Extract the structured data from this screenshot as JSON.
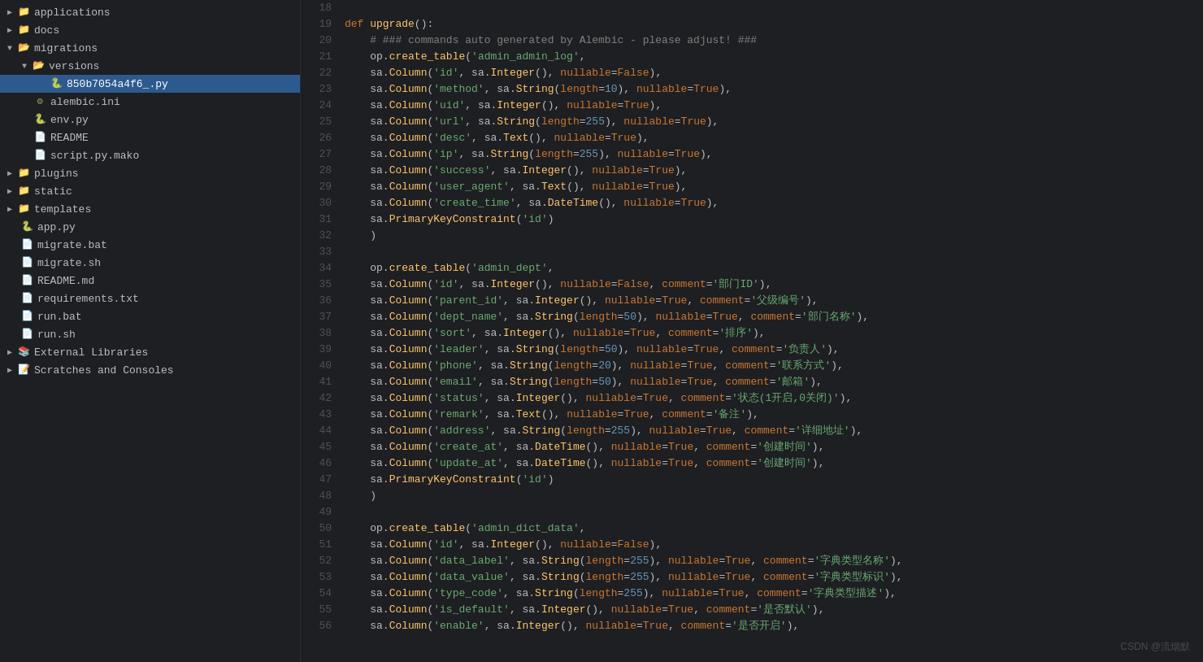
{
  "sidebar": {
    "items": [
      {
        "id": "applications",
        "label": "applications",
        "level": 1,
        "type": "folder",
        "expanded": false,
        "arrow": "▶"
      },
      {
        "id": "docs",
        "label": "docs",
        "level": 1,
        "type": "folder",
        "expanded": false,
        "arrow": "▶"
      },
      {
        "id": "migrations",
        "label": "migrations",
        "level": 1,
        "type": "folder",
        "expanded": true,
        "arrow": "▼"
      },
      {
        "id": "versions",
        "label": "versions",
        "level": 2,
        "type": "folder",
        "expanded": true,
        "arrow": "▼"
      },
      {
        "id": "850b7054a4f6_py",
        "label": "850b7054a4f6_.py",
        "level": 3,
        "type": "py",
        "selected": true
      },
      {
        "id": "alembic_ini",
        "label": "alembic.ini",
        "level": 2,
        "type": "ini"
      },
      {
        "id": "env_py",
        "label": "env.py",
        "level": 2,
        "type": "py"
      },
      {
        "id": "README",
        "label": "README",
        "level": 2,
        "type": "txt"
      },
      {
        "id": "script_py_mako",
        "label": "script.py.mako",
        "level": 2,
        "type": "mako"
      },
      {
        "id": "plugins",
        "label": "plugins",
        "level": 1,
        "type": "folder",
        "expanded": false,
        "arrow": "▶"
      },
      {
        "id": "static",
        "label": "static",
        "level": 1,
        "type": "folder",
        "expanded": false,
        "arrow": "▶"
      },
      {
        "id": "templates",
        "label": "templates",
        "level": 1,
        "type": "folder",
        "expanded": false,
        "arrow": "▶"
      },
      {
        "id": "app_py",
        "label": "app.py",
        "level": 1,
        "type": "py"
      },
      {
        "id": "migrate_bat",
        "label": "migrate.bat",
        "level": 1,
        "type": "bat"
      },
      {
        "id": "migrate_sh",
        "label": "migrate.sh",
        "level": 1,
        "type": "sh"
      },
      {
        "id": "README_md",
        "label": "README.md",
        "level": 1,
        "type": "md"
      },
      {
        "id": "requirements_txt",
        "label": "requirements.txt",
        "level": 1,
        "type": "txt"
      },
      {
        "id": "run_bat",
        "label": "run.bat",
        "level": 1,
        "type": "bat"
      },
      {
        "id": "run_sh",
        "label": "run.sh",
        "level": 1,
        "type": "sh"
      },
      {
        "id": "external_libraries",
        "label": "External Libraries",
        "level": 0,
        "type": "lib",
        "expanded": false,
        "arrow": "▶"
      },
      {
        "id": "scratches",
        "label": "Scratches and Consoles",
        "level": 0,
        "type": "scratch",
        "expanded": false,
        "arrow": "▶"
      }
    ]
  },
  "code_lines": [
    {
      "num": 18,
      "content": ""
    },
    {
      "num": 19,
      "content": "def_upgrade():"
    },
    {
      "num": 20,
      "content": "    # ### commands auto generated by Alembic - please adjust! ###"
    },
    {
      "num": 21,
      "content": "    op.create_table('admin_admin_log',"
    },
    {
      "num": 22,
      "content": "    sa.Column('id', sa.Integer(), nullable=False),"
    },
    {
      "num": 23,
      "content": "    sa.Column('method', sa.String(length=10), nullable=True),"
    },
    {
      "num": 24,
      "content": "    sa.Column('uid', sa.Integer(), nullable=True),"
    },
    {
      "num": 25,
      "content": "    sa.Column('url', sa.String(length=255), nullable=True),"
    },
    {
      "num": 26,
      "content": "    sa.Column('desc', sa.Text(), nullable=True),"
    },
    {
      "num": 27,
      "content": "    sa.Column('ip', sa.String(length=255), nullable=True),"
    },
    {
      "num": 28,
      "content": "    sa.Column('success', sa.Integer(), nullable=True),"
    },
    {
      "num": 29,
      "content": "    sa.Column('user_agent', sa.Text(), nullable=True),"
    },
    {
      "num": 30,
      "content": "    sa.Column('create_time', sa.DateTime(), nullable=True),"
    },
    {
      "num": 31,
      "content": "    sa.PrimaryKeyConstraint('id')"
    },
    {
      "num": 32,
      "content": "    )"
    },
    {
      "num": 33,
      "content": ""
    },
    {
      "num": 34,
      "content": "    op.create_table('admin_dept',"
    },
    {
      "num": 35,
      "content": "    sa.Column('id', sa.Integer(), nullable=False, comment='部门ID'),"
    },
    {
      "num": 36,
      "content": "    sa.Column('parent_id', sa.Integer(), nullable=True, comment='父级编号'),"
    },
    {
      "num": 37,
      "content": "    sa.Column('dept_name', sa.String(length=50), nullable=True, comment='部门名称'),"
    },
    {
      "num": 38,
      "content": "    sa.Column('sort', sa.Integer(), nullable=True, comment='排序'),"
    },
    {
      "num": 39,
      "content": "    sa.Column('leader', sa.String(length=50), nullable=True, comment='负责人'),"
    },
    {
      "num": 40,
      "content": "    sa.Column('phone', sa.String(length=20), nullable=True, comment='联系方式'),"
    },
    {
      "num": 41,
      "content": "    sa.Column('email', sa.String(length=50), nullable=True, comment='邮箱'),"
    },
    {
      "num": 42,
      "content": "    sa.Column('status', sa.Integer(), nullable=True, comment='状态(1开启,0关闭)'),"
    },
    {
      "num": 43,
      "content": "    sa.Column('remark', sa.Text(), nullable=True, comment='备注'),"
    },
    {
      "num": 44,
      "content": "    sa.Column('address', sa.String(length=255), nullable=True, comment='详细地址'),"
    },
    {
      "num": 45,
      "content": "    sa.Column('create_at', sa.DateTime(), nullable=True, comment='创建时间'),"
    },
    {
      "num": 46,
      "content": "    sa.Column('update_at', sa.DateTime(), nullable=True, comment='创建时间'),"
    },
    {
      "num": 47,
      "content": "    sa.PrimaryKeyConstraint('id')"
    },
    {
      "num": 48,
      "content": "    )"
    },
    {
      "num": 49,
      "content": ""
    },
    {
      "num": 50,
      "content": "    op.create_table('admin_dict_data',"
    },
    {
      "num": 51,
      "content": "    sa.Column('id', sa.Integer(), nullable=False),"
    },
    {
      "num": 52,
      "content": "    sa.Column('data_label', sa.String(length=255), nullable=True, comment='字典类型名称'),"
    },
    {
      "num": 53,
      "content": "    sa.Column('data_value', sa.String(length=255), nullable=True, comment='字典类型标识'),"
    },
    {
      "num": 54,
      "content": "    sa.Column('type_code', sa.String(length=255), nullable=True, comment='字典类型描述'),"
    },
    {
      "num": 55,
      "content": "    sa.Column('is_default', sa.Integer(), nullable=True, comment='是否默认'),"
    },
    {
      "num": 56,
      "content": "    sa.Column('enable', sa.Integer(), nullable=True, comment='是否开启'),"
    }
  ],
  "watermark": "CSDN @流烟默"
}
